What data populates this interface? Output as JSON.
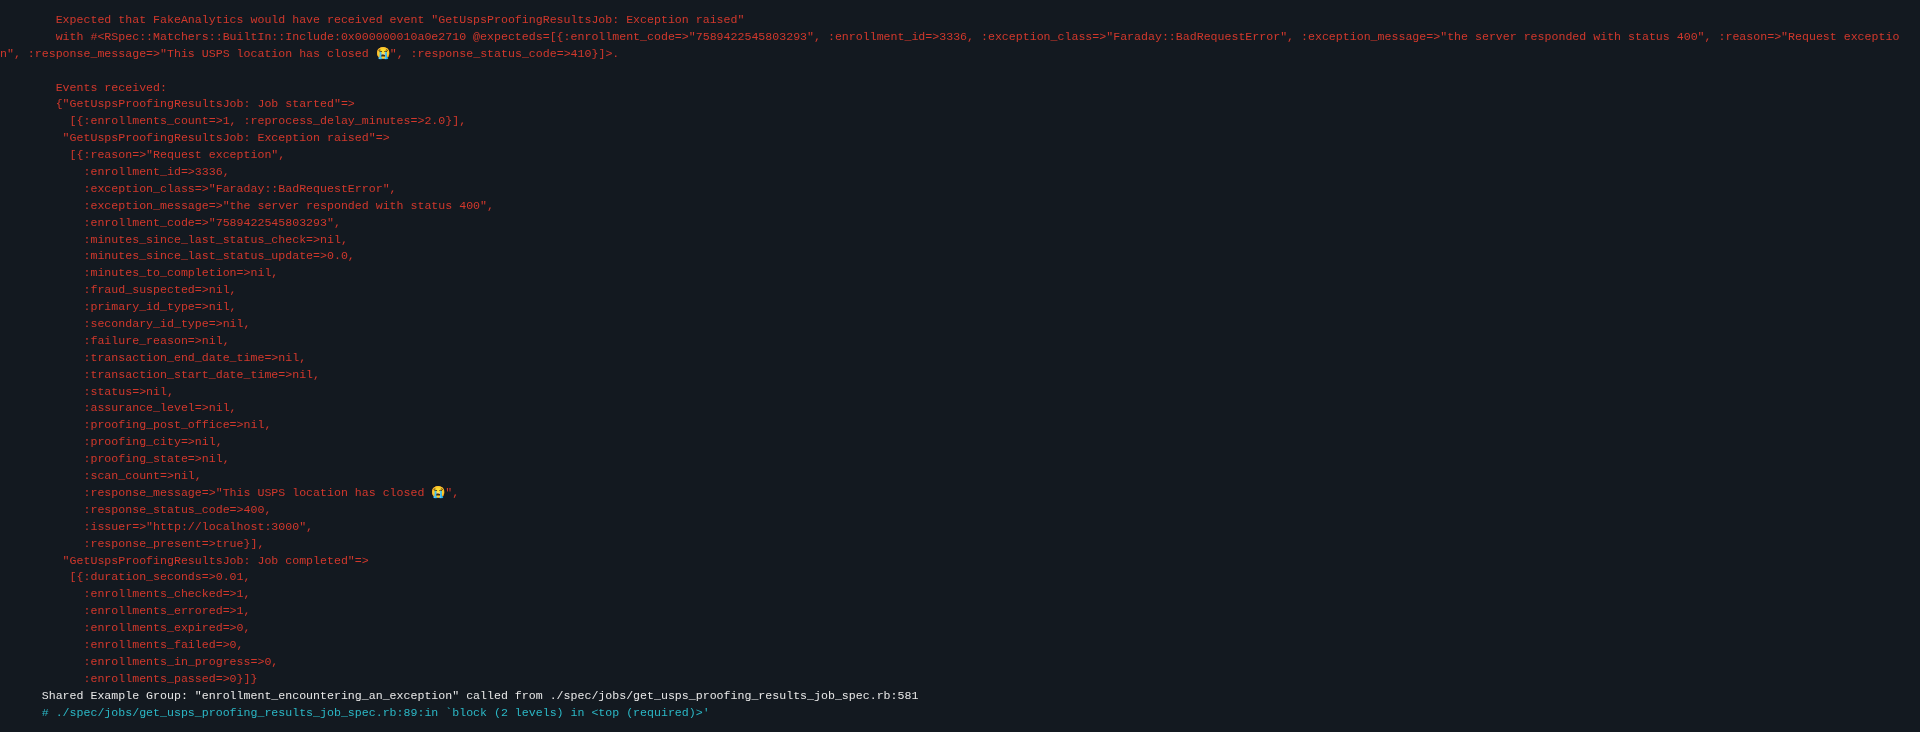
{
  "failure_message": [
    "        Expected that FakeAnalytics would have received event \"GetUspsProofingResultsJob: Exception raised\"",
    "        with #<RSpec::Matchers::BuiltIn::Include:0x000000010a0e2710 @expecteds=[{:enrollment_code=>\"7589422545803293\", :enrollment_id=>3336, :exception_class=>\"Faraday::BadRequestError\", :exception_message=>\"the server responded with status 400\", :reason=>\"Request exceptio",
    "n\", :response_message=>\"This USPS location has closed 😭\", :response_status_code=>410}]>."
  ],
  "events_received": [
    "        Events received:",
    "        {\"GetUspsProofingResultsJob: Job started\"=>",
    "          [{:enrollments_count=>1, :reprocess_delay_minutes=>2.0}],",
    "         \"GetUspsProofingResultsJob: Exception raised\"=>",
    "          [{:reason=>\"Request exception\",",
    "            :enrollment_id=>3336,",
    "            :exception_class=>\"Faraday::BadRequestError\",",
    "            :exception_message=>\"the server responded with status 400\",",
    "            :enrollment_code=>\"7589422545803293\",",
    "            :minutes_since_last_status_check=>nil,",
    "            :minutes_since_last_status_update=>0.0,",
    "            :minutes_to_completion=>nil,",
    "            :fraud_suspected=>nil,",
    "            :primary_id_type=>nil,",
    "            :secondary_id_type=>nil,",
    "            :failure_reason=>nil,",
    "            :transaction_end_date_time=>nil,",
    "            :transaction_start_date_time=>nil,",
    "            :status=>nil,",
    "            :assurance_level=>nil,",
    "            :proofing_post_office=>nil,",
    "            :proofing_city=>nil,",
    "            :proofing_state=>nil,",
    "            :scan_count=>nil,",
    "            :response_message=>\"This USPS location has closed 😭\",",
    "            :response_status_code=>400,",
    "            :issuer=>\"http://localhost:3000\",",
    "            :response_present=>true}],",
    "         \"GetUspsProofingResultsJob: Job completed\"=>",
    "          [{:duration_seconds=>0.01,",
    "            :enrollments_checked=>1,",
    "            :enrollments_errored=>1,",
    "            :enrollments_expired=>0,",
    "            :enrollments_failed=>0,",
    "            :enrollments_in_progress=>0,",
    "            :enrollments_passed=>0}]}"
  ],
  "footer": [
    {
      "kind": "info",
      "text": "      Shared Example Group: \"enrollment_encountering_an_exception\" called from ./spec/jobs/get_usps_proofing_results_job_spec.rb:581"
    },
    {
      "kind": "comment",
      "text": "      # ./spec/jobs/get_usps_proofing_results_job_spec.rb:89:in `block (2 levels) in <top (required)>'"
    }
  ]
}
